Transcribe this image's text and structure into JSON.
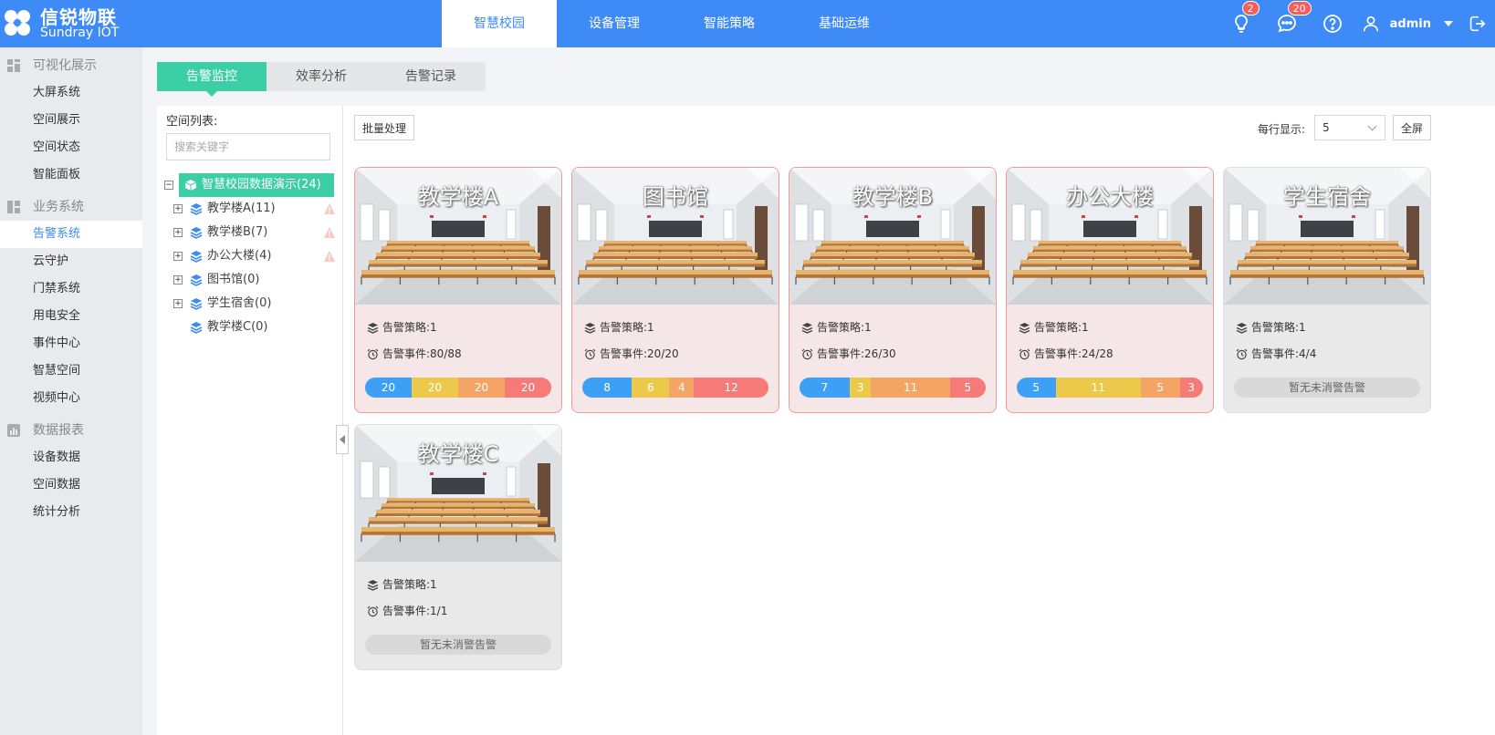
{
  "brand": {
    "title": "信锐物联",
    "subtitle": "Sundray IOT"
  },
  "nav": [
    {
      "label": "智慧校园",
      "active": true
    },
    {
      "label": "设备管理",
      "active": false
    },
    {
      "label": "智能策略",
      "active": false
    },
    {
      "label": "基础运维",
      "active": false
    }
  ],
  "header": {
    "notifications_badge": "2",
    "messages_badge": "20",
    "username": "admin"
  },
  "sidebar": {
    "groups": [
      {
        "title": "可视化展示",
        "icon": "dashboard-icon",
        "items": [
          {
            "label": "大屏系统",
            "active": false
          },
          {
            "label": "空间展示",
            "active": false
          },
          {
            "label": "空间状态",
            "active": false
          },
          {
            "label": "智能面板",
            "active": false
          }
        ]
      },
      {
        "title": "业务系统",
        "icon": "business-icon",
        "items": [
          {
            "label": "告警系统",
            "active": true
          },
          {
            "label": "云守护",
            "active": false
          },
          {
            "label": "门禁系统",
            "active": false
          },
          {
            "label": "用电安全",
            "active": false
          },
          {
            "label": "事件中心",
            "active": false
          },
          {
            "label": "智慧空间",
            "active": false
          },
          {
            "label": "视频中心",
            "active": false
          }
        ]
      },
      {
        "title": "数据报表",
        "icon": "report-icon",
        "items": [
          {
            "label": "设备数据",
            "active": false
          },
          {
            "label": "空间数据",
            "active": false
          },
          {
            "label": "统计分析",
            "active": false
          }
        ]
      }
    ]
  },
  "tabs": [
    {
      "label": "告警监控",
      "active": true
    },
    {
      "label": "效率分析",
      "active": false
    },
    {
      "label": "告警记录",
      "active": false
    }
  ],
  "tree": {
    "label": "空间列表:",
    "search_placeholder": "搜索关键字",
    "root": "智慧校园数据演示(24)",
    "nodes": [
      {
        "label": "教学楼A(11)",
        "expandable": true,
        "warning": true
      },
      {
        "label": "教学楼B(7)",
        "expandable": true,
        "warning": true
      },
      {
        "label": "办公大楼(4)",
        "expandable": true,
        "warning": true
      },
      {
        "label": "图书馆(0)",
        "expandable": true,
        "warning": false
      },
      {
        "label": "学生宿舍(0)",
        "expandable": true,
        "warning": false
      },
      {
        "label": "教学楼C(0)",
        "expandable": false,
        "warning": false
      }
    ]
  },
  "toolbar": {
    "batch_label": "批量处理",
    "per_row_label": "每行显示:",
    "per_row_value": "5",
    "fullscreen_label": "全屏"
  },
  "card_labels": {
    "policy_prefix": "告警策略:",
    "events_prefix": "告警事件:",
    "no_alarm": "暂无未消警告警"
  },
  "cards": [
    {
      "title": "教学楼A",
      "policy": "1",
      "events": "80/88",
      "alarm": true,
      "segments": [
        20,
        20,
        20,
        20
      ]
    },
    {
      "title": "图书馆",
      "policy": "1",
      "events": "20/20",
      "alarm": true,
      "segments": [
        8,
        6,
        4,
        12
      ]
    },
    {
      "title": "教学楼B",
      "policy": "1",
      "events": "26/30",
      "alarm": true,
      "segments": [
        7,
        3,
        11,
        5
      ]
    },
    {
      "title": "办公大楼",
      "policy": "1",
      "events": "24/28",
      "alarm": true,
      "segments": [
        5,
        11,
        5,
        3
      ]
    },
    {
      "title": "学生宿舍",
      "policy": "1",
      "events": "4/4",
      "alarm": false,
      "segments": []
    },
    {
      "title": "教学楼C",
      "policy": "1",
      "events": "1/1",
      "alarm": false,
      "segments": []
    }
  ],
  "colors": {
    "primary": "#3e8bf7",
    "accent": "#3ccfa6",
    "seg1": "#3ea0f5",
    "seg2": "#ecc94a",
    "seg3": "#f4a566",
    "seg4": "#f57a78"
  }
}
